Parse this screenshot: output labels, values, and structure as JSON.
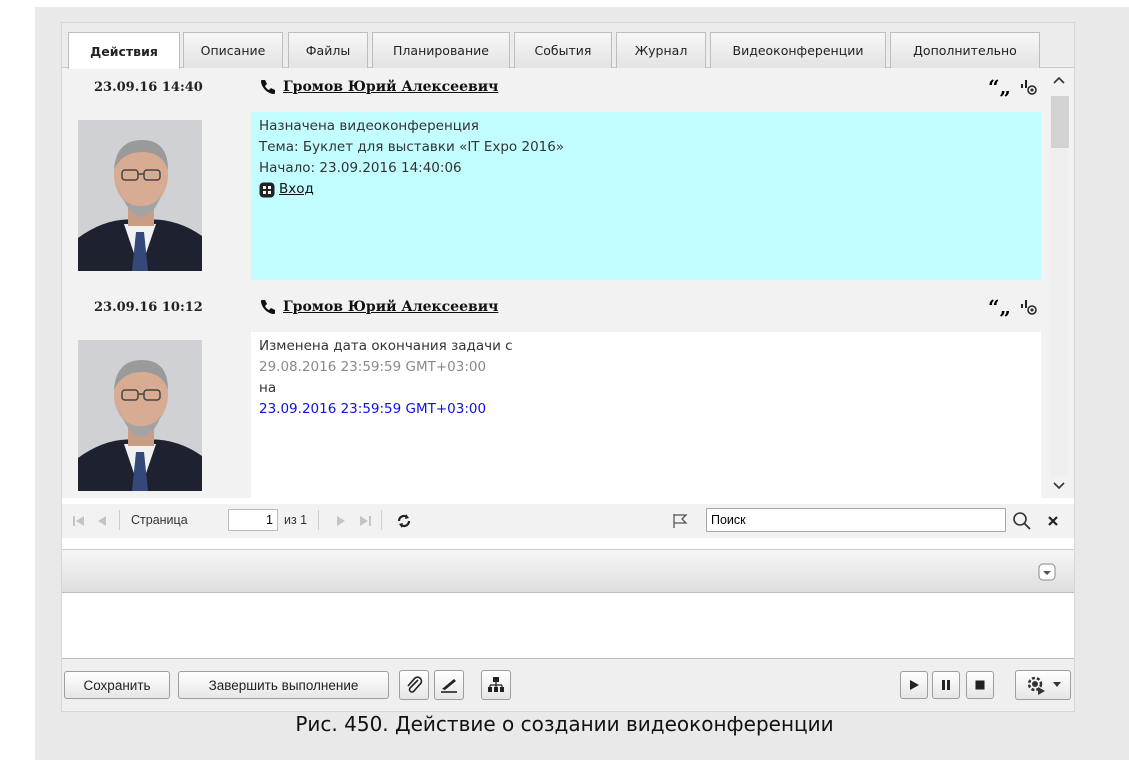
{
  "tabs": [
    {
      "label": "Действия",
      "active": true
    },
    {
      "label": "Описание"
    },
    {
      "label": "Файлы"
    },
    {
      "label": "Планирование"
    },
    {
      "label": "События"
    },
    {
      "label": "Журнал"
    },
    {
      "label": "Видеоконференции"
    },
    {
      "label": "Дополнительно"
    }
  ],
  "entries": [
    {
      "date": "23.09.16 14:40",
      "author": "Громов Юрий Алексеевич",
      "lines": [
        "Назначена видеоконференция",
        "Тема: Буклет для выставки «IT Expo 2016»",
        "Начало: 23.09.2016 14:40:06"
      ],
      "link": "Вход",
      "bg": "#c2feff"
    },
    {
      "date": "23.09.16 10:12",
      "author": "Громов Юрий Алексеевич",
      "line1": "Изменена дата окончания задачи с",
      "old_value": "29.08.2016 23:59:59 GMT+03:00",
      "line3": "на",
      "new_value": "23.09.2016 23:59:59 GMT+03:00"
    }
  ],
  "pager": {
    "page_label": "Страница",
    "page_value": "1",
    "of_label": "из 1",
    "search_placeholder": "Поиск"
  },
  "toolbar": {
    "save_label": "Сохранить",
    "complete_label": "Завершить выполнение"
  },
  "caption": "Рис. 450. Действие о создании видеоконференции",
  "colors": {
    "highlight": "#c2feff",
    "new_value": "#1010e0",
    "old_value": "#8a8a8a"
  }
}
